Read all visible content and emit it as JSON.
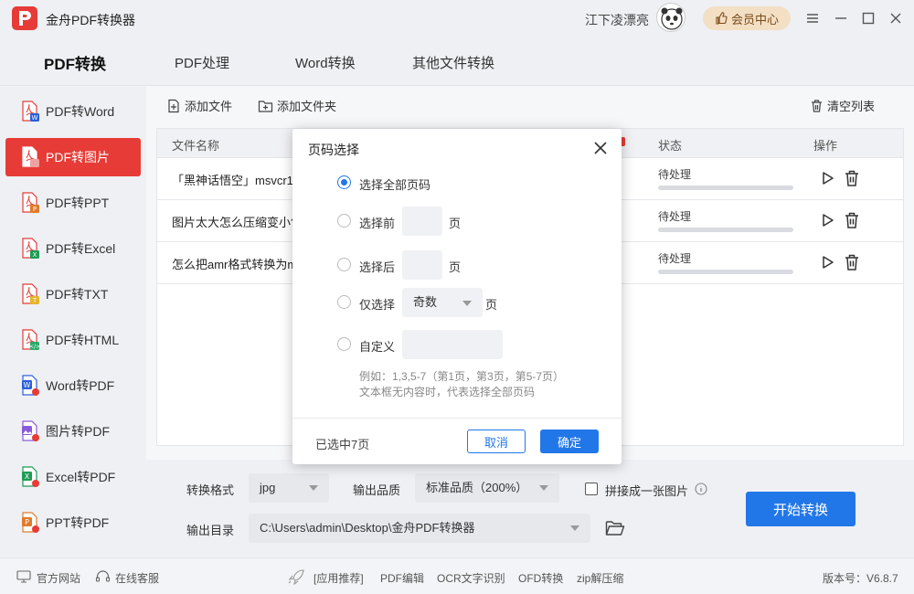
{
  "app": {
    "title": "金舟PDF转换器",
    "username": "江下凌漂亮",
    "member_label": "会员中心"
  },
  "topnav": {
    "tabs": [
      "PDF转换",
      "PDF处理",
      "Word转换",
      "其他文件转换"
    ],
    "active": 0
  },
  "sidebar": {
    "items": [
      {
        "label": "PDF转Word",
        "badge": "W",
        "badge_color": "#2b5fd9"
      },
      {
        "label": "PDF转图片",
        "badge": "",
        "badge_color": "#e63b36"
      },
      {
        "label": "PDF转PPT",
        "badge": "P",
        "badge_color": "#e07a2a"
      },
      {
        "label": "PDF转Excel",
        "badge": "X",
        "badge_color": "#1e9b54"
      },
      {
        "label": "PDF转TXT",
        "badge": "T",
        "badge_color": "#e6b52a"
      },
      {
        "label": "PDF转HTML",
        "badge": "H",
        "badge_color": "#2aaa6a"
      },
      {
        "label": "Word转PDF",
        "badge": "W",
        "badge_color": "#2b5fd9"
      },
      {
        "label": "图片转PDF",
        "badge": "",
        "badge_color": "#8a5ad9"
      },
      {
        "label": "Excel转PDF",
        "badge": "X",
        "badge_color": "#1e9b54"
      },
      {
        "label": "PPT转PDF",
        "badge": "P",
        "badge_color": "#e07a2a"
      }
    ],
    "active": 1
  },
  "toolbar": {
    "add_file": "添加文件",
    "add_folder": "添加文件夹",
    "clear_list": "清空列表"
  },
  "table": {
    "headers": {
      "name": "文件名称",
      "status": "状态",
      "actions": "操作"
    },
    "rows": [
      {
        "name": "「黑神话悟空」msvcr1",
        "status": "待处理",
        "progress": 0
      },
      {
        "name": "图片太大怎么压缩变小?",
        "status": "待处理",
        "progress": 0
      },
      {
        "name": "怎么把amr格式转换为m",
        "status": "待处理",
        "progress": 0
      }
    ]
  },
  "settings": {
    "format_label": "转换格式",
    "format_value": "jpg",
    "quality_label": "输出品质",
    "quality_value": "标准品质（200%）",
    "merge_label": "拼接成一张图片",
    "output_label": "输出目录",
    "output_value": "C:\\Users\\admin\\Desktop\\金舟PDF转换器",
    "start_label": "开始转换"
  },
  "statusbar": {
    "website": "官方网站",
    "support": "在线客服",
    "recommend": "[应用推荐]",
    "links": [
      "PDF编辑",
      "OCR文字识别",
      "OFD转换",
      "zip解压缩"
    ],
    "version": "版本号：V6.8.7"
  },
  "dialog": {
    "title": "页码选择",
    "opt_all": "选择全部页码",
    "opt_first": "选择前",
    "opt_last": "选择后",
    "opt_only": "仅选择",
    "opt_custom": "自定义",
    "page_unit": "页",
    "only_value": "奇数",
    "hint1": "例如：1,3,5-7（第1页，第3页，第5-7页）",
    "hint2": "文本框无内容时，代表选择全部页码",
    "selected_count": "已选中7页",
    "cancel": "取消",
    "ok": "确定"
  },
  "colors": {
    "accent": "#e63b36",
    "primary": "#2277e8"
  }
}
